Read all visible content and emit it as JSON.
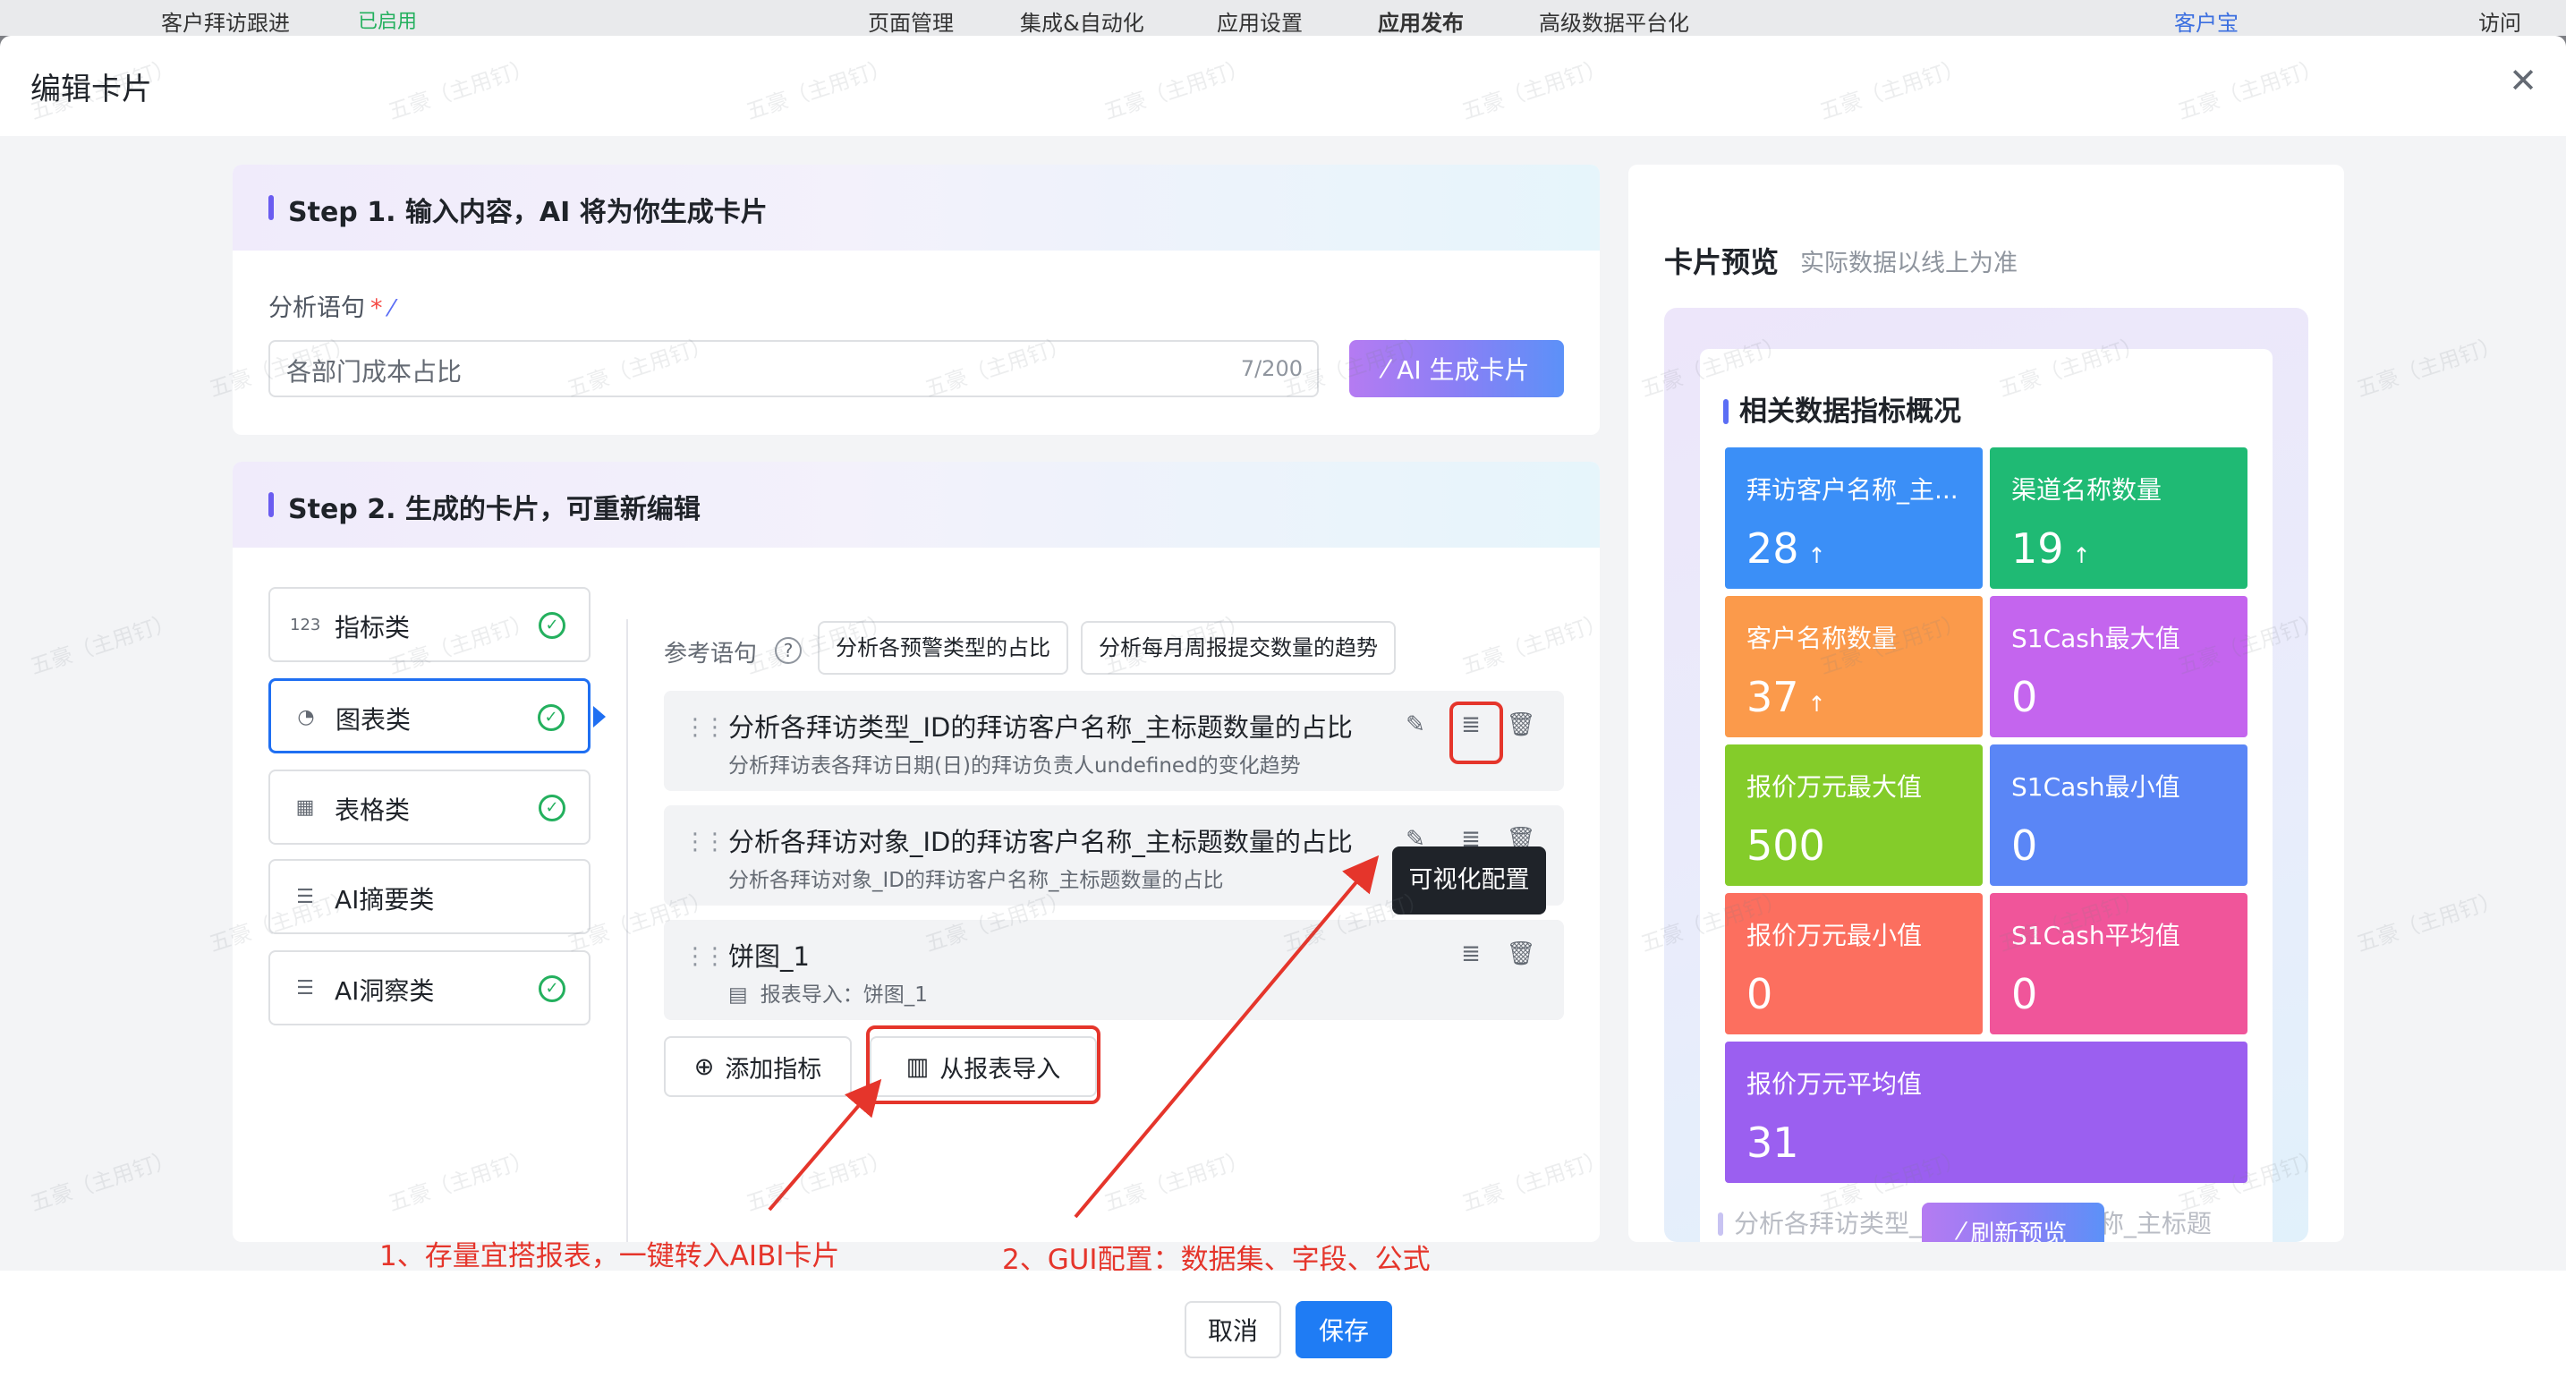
{
  "app": {
    "bg_title": "客户拜访跟进",
    "bg_badge": "已启用",
    "bg_tabs": [
      "页面管理",
      "集成&自动化",
      "应用设置",
      "应用发布",
      "高级数据平台化"
    ],
    "bg_user": "客户宝",
    "bg_button": "访问"
  },
  "modal": {
    "title": "编辑卡片",
    "close_icon": "close-icon"
  },
  "step1": {
    "title": "Step 1. 输入内容，AI 将为你生成卡片",
    "field_label": "分析语句",
    "required_mark": "*",
    "input_value": "各部门成本占比",
    "char_count": "7/200",
    "generate_button": "AI 生成卡片"
  },
  "step2": {
    "title": "Step 2. 生成的卡片，可重新编辑",
    "categories": [
      {
        "icon": "123",
        "label": "指标类",
        "done": true
      },
      {
        "icon": "pie-chart-icon",
        "label": "图表类",
        "done": true,
        "active": true
      },
      {
        "icon": "table-icon",
        "label": "表格类",
        "done": true
      },
      {
        "icon": "list-icon",
        "label": "AI摘要类",
        "done": false
      },
      {
        "icon": "list-icon",
        "label": "AI洞察类",
        "done": true
      }
    ],
    "reference_label": "参考语句",
    "reference_chips": [
      "分析各预警类型的占比",
      "分析每月周报提交数量的趋势"
    ],
    "items": [
      {
        "title": "分析各拜访类型_ID的拜访客户名称_主标题数量的占比",
        "subtitle": "分析拜访表各拜访日期(日)的拜访负责人undefined的变化趋势"
      },
      {
        "title": "分析各拜访对象_ID的拜访客户名称_主标题数量的占比",
        "subtitle": "分析各拜访对象_ID的拜访客户名称_主标题数量的占比"
      },
      {
        "title": "饼图_1",
        "subtitle": "报表导入：饼图_1"
      }
    ],
    "tooltip": "可视化配置",
    "add_button": "添加指标",
    "import_button": "从报表导入"
  },
  "annotations": {
    "note1": "1、存量宜搭报表，一键转入AIBI卡片",
    "note2": "2、GUI配置：数据集、字段、公式"
  },
  "preview": {
    "title": "卡片预览",
    "subtitle": "实际数据以线上为准",
    "section_title": "相关数据指标概况",
    "tiles": [
      {
        "name": "拜访客户名称_主...",
        "value": "28",
        "trend": "↑",
        "color": "#3b8ff7"
      },
      {
        "name": "渠道名称数量",
        "value": "19",
        "trend": "↑",
        "color": "#1fba74"
      },
      {
        "name": "客户名称数量",
        "value": "37",
        "trend": "↑",
        "color": "#fb9a4b"
      },
      {
        "name": "S1Cash最大值",
        "value": "0",
        "trend": "",
        "color": "#c465ee"
      },
      {
        "name": "报价万元最大值",
        "value": "500",
        "trend": "",
        "color": "#84cc2a"
      },
      {
        "name": "S1Cash最小值",
        "value": "0",
        "trend": "",
        "color": "#5a86f6"
      },
      {
        "name": "报价万元最小值",
        "value": "0",
        "trend": "",
        "color": "#fc6f5f"
      },
      {
        "name": "S1Cash平均值",
        "value": "0",
        "trend": "",
        "color": "#f0559a"
      },
      {
        "name": "报价万元平均值",
        "value": "31",
        "trend": "",
        "color": "#9b5ff0"
      }
    ],
    "next_section": "分析各拜访类型_ID的拜访客户名称_主标题",
    "refresh_button": "刷新预览"
  },
  "footer": {
    "cancel": "取消",
    "save": "保存"
  },
  "watermark": "五豪（主用钉）",
  "colors": {
    "primary": "#1f6ff2",
    "accent": "#5b6ef5",
    "annotation": "#e5352b"
  }
}
